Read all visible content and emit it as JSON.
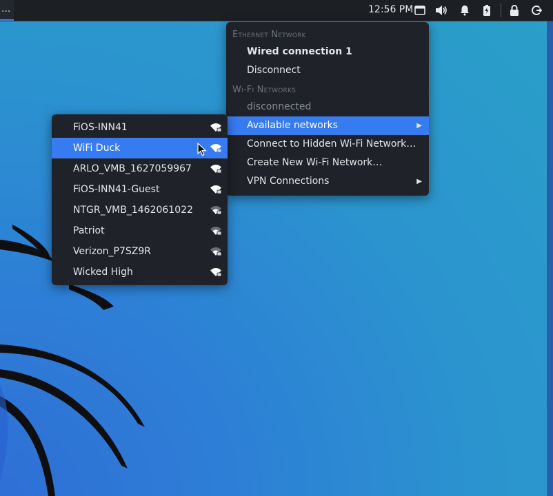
{
  "topbar": {
    "left_label": "...",
    "clock": "12:56 PM",
    "icons": [
      "window-icon",
      "volume-icon",
      "bell-icon",
      "battery-icon",
      "lock-icon",
      "logout-icon"
    ]
  },
  "main_menu": {
    "ethernet_header": "Ethernet Network",
    "wired_connection": "Wired connection 1",
    "disconnect": "Disconnect",
    "wifi_header": "Wi-Fi Networks",
    "wifi_status": "disconnected",
    "available_networks": "Available networks",
    "connect_hidden": "Connect to Hidden Wi-Fi Network…",
    "create_new": "Create New Wi-Fi Network…",
    "vpn_connections": "VPN Connections"
  },
  "networks": [
    {
      "ssid": "FiOS-INN41"
    },
    {
      "ssid": "WiFi Duck"
    },
    {
      "ssid": "ARLO_VMB_1627059967"
    },
    {
      "ssid": "FiOS-INN41-Guest"
    },
    {
      "ssid": "NTGR_VMB_1462061022"
    },
    {
      "ssid": "Patriot"
    },
    {
      "ssid": "Verizon_P7SZ9R"
    },
    {
      "ssid": "Wicked High"
    }
  ],
  "colors": {
    "accent": "#367bf0",
    "menu_bg": "#1f2228",
    "topbar_bg": "#1c1f24"
  }
}
